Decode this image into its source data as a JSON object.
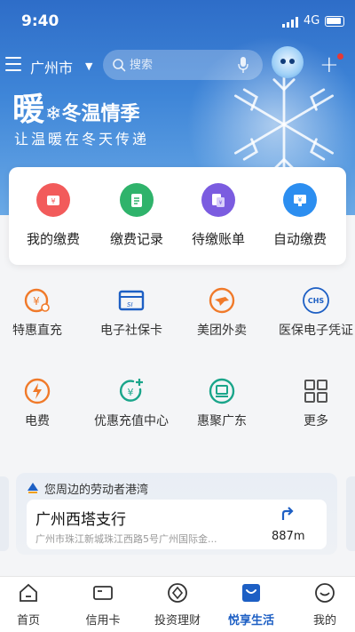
{
  "status_bar": {
    "time": "9:40",
    "network": "4G"
  },
  "header": {
    "city": "广州市",
    "search_placeholder": "搜索"
  },
  "banner": {
    "title_big": "暖",
    "title_rest": "冬温情季",
    "subtitle": "让温暖在冬天传递"
  },
  "quick_actions": [
    {
      "label": "我的缴费",
      "icon": "wallet-icon",
      "color": "#f25b5b"
    },
    {
      "label": "缴费记录",
      "icon": "record-icon",
      "color": "#2fb36b"
    },
    {
      "label": "待缴账单",
      "icon": "bill-icon",
      "color": "#7b5ce0"
    },
    {
      "label": "自动缴费",
      "icon": "auto-pay-icon",
      "color": "#2c8ef0"
    }
  ],
  "services": [
    {
      "label": "特惠直充",
      "icon": "topup-icon"
    },
    {
      "label": "电子社保卡",
      "icon": "social-security-card-icon"
    },
    {
      "label": "美团外卖",
      "icon": "meituan-icon"
    },
    {
      "label": "医保电子凭证",
      "icon": "medical-insurance-icon"
    },
    {
      "label": "电费",
      "icon": "electricity-icon"
    },
    {
      "label": "优惠充值中心",
      "icon": "recharge-center-icon"
    },
    {
      "label": "惠聚广东",
      "icon": "huiju-guangdong-icon"
    },
    {
      "label": "更多",
      "icon": "more-grid-icon"
    }
  ],
  "nearby": {
    "header": "您周边的劳动者港湾",
    "branch_name": "广州西塔支行",
    "address": "广州市珠江新城珠江西路5号广州国际金...",
    "distance": "887m"
  },
  "bottom_nav": [
    {
      "label": "首页",
      "icon": "home-icon"
    },
    {
      "label": "信用卡",
      "icon": "credit-card-icon"
    },
    {
      "label": "投资理财",
      "icon": "investment-icon"
    },
    {
      "label": "悦享生活",
      "icon": "life-icon",
      "active": true
    },
    {
      "label": "我的",
      "icon": "profile-icon"
    }
  ],
  "colors": {
    "primary": "#1d5fc4",
    "orange": "#f07a2a",
    "teal": "#1aa58a"
  }
}
